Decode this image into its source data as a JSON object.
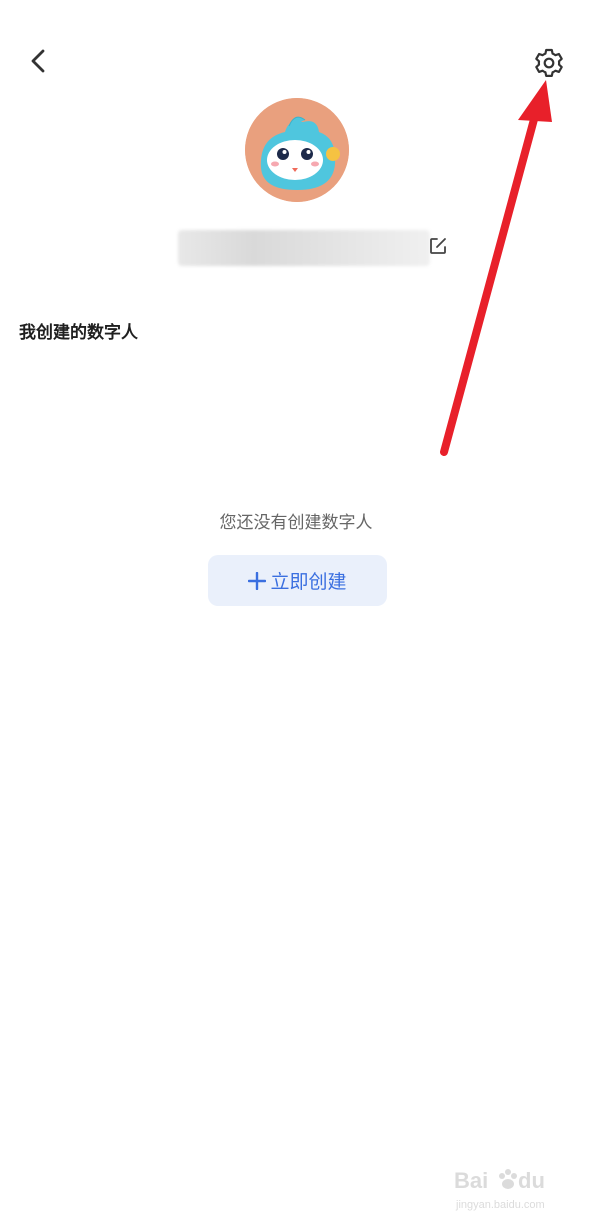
{
  "header": {
    "back_icon": "chevron-left-icon",
    "settings_icon": "gear-icon"
  },
  "profile": {
    "avatar_icon": "mascot-avatar",
    "username": "",
    "edit_icon": "edit-icon"
  },
  "section": {
    "title": "我创建的数字人"
  },
  "empty_state": {
    "message": "您还没有创建数字人",
    "create_button_icon": "plus-icon",
    "create_button_label": "立即创建"
  },
  "colors": {
    "accent": "#3a6fe0",
    "button_bg": "#eaf0fb",
    "annotation_arrow": "#e8202a",
    "avatar_bg": "#e9a07e"
  },
  "watermark": {
    "brand": "Baidu经验",
    "url": "jingyan.baidu.com"
  }
}
